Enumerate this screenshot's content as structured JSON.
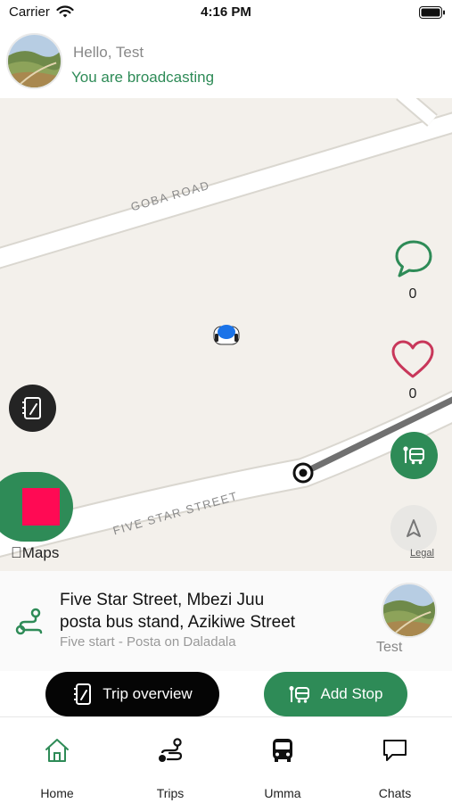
{
  "status_bar": {
    "carrier": "Carrier",
    "time": "4:16 PM"
  },
  "header": {
    "greeting": "Hello, Test",
    "status": "You are broadcasting"
  },
  "map": {
    "road_labels": [
      "GOBA ROAD",
      "FIVE STAR STREET"
    ],
    "comments_count": "0",
    "likes_count": "0",
    "maps_brand": "Maps",
    "legal_link": "Legal"
  },
  "route_card": {
    "title_line1": "Five Star Street, Mbezi Juu",
    "title_line2": "posta bus stand, Azikiwe Street",
    "subtitle": "Five start - Posta on Daladala",
    "driver_name": "Test"
  },
  "actions": {
    "trip_overview_label": "Trip overview",
    "add_stop_label": "Add Stop"
  },
  "tabbar": {
    "items": [
      {
        "label": "Home",
        "icon": "home-icon",
        "active": true
      },
      {
        "label": "Trips",
        "icon": "route-icon",
        "active": false
      },
      {
        "label": "Umma",
        "icon": "bus-icon",
        "active": false
      },
      {
        "label": "Chats",
        "icon": "chat-icon",
        "active": false
      }
    ]
  },
  "colors": {
    "accent": "#2e8b57",
    "heart": "#c8375a",
    "stop_square": "#ff0a54",
    "map_bg": "#f3f0eb",
    "dark_button": "#050505"
  }
}
